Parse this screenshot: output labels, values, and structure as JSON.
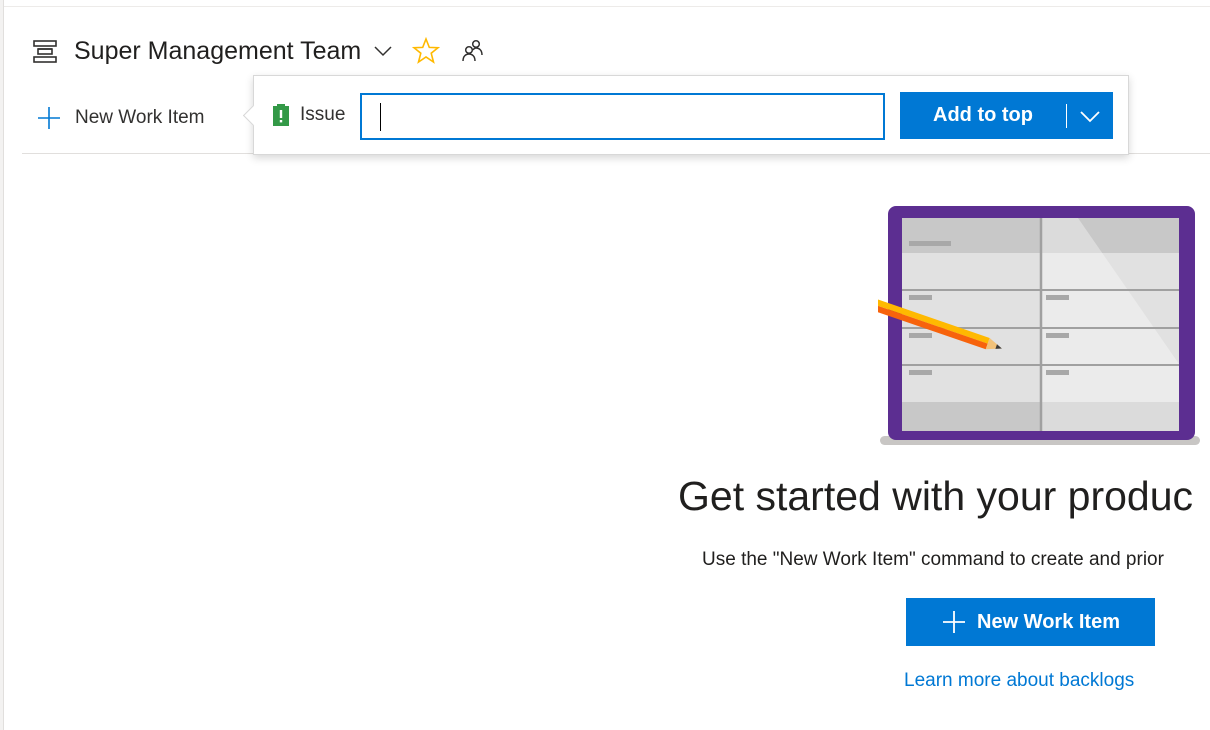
{
  "header": {
    "team_name": "Super Management Team",
    "icons": [
      "backlog-icon",
      "chevron-down-icon",
      "star-icon",
      "team-members-icon"
    ]
  },
  "toolbar": {
    "new_work_item_label": "New Work Item"
  },
  "callout": {
    "work_item_type": "Issue",
    "title_value": "",
    "title_placeholder": "",
    "add_button_label": "Add to top"
  },
  "empty_state": {
    "headline": "Get started with your produc",
    "description": "Use the \"New Work Item\" command to create and prior",
    "new_work_item_button": "New Work Item",
    "learn_more_link": "Learn more about backlogs"
  },
  "colors": {
    "accent": "#0078d4",
    "star": "#ffb900",
    "issue_icon": "#339947",
    "board_frame": "#5c2e91",
    "text": "#201f1e"
  }
}
